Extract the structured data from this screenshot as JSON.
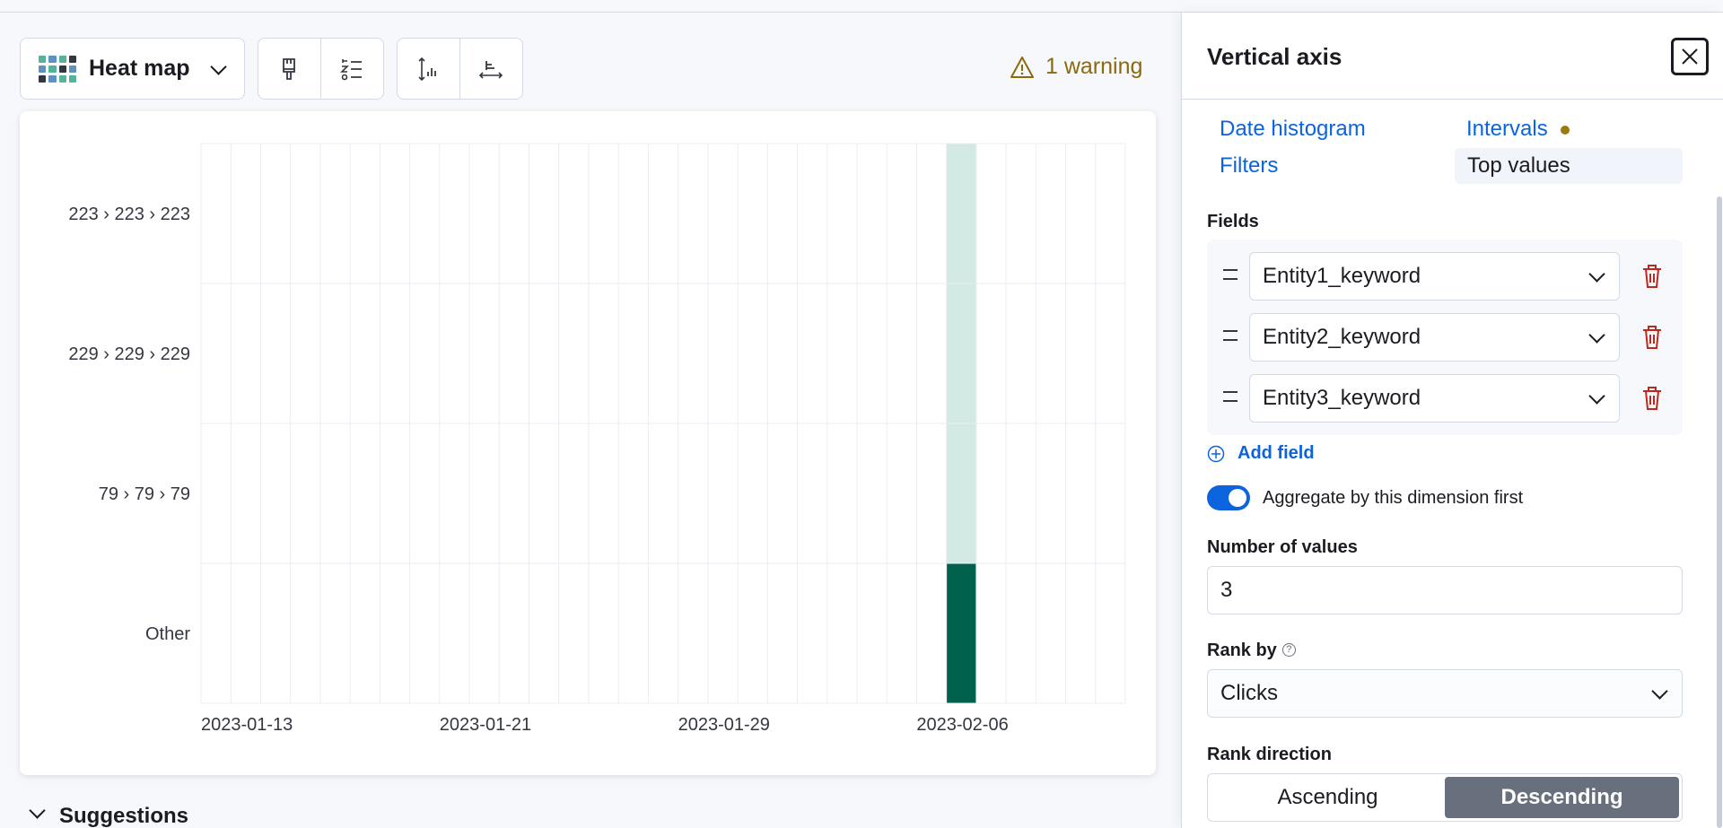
{
  "toolbar": {
    "chart_type_label": "Heat map",
    "warning_label": "1 warning"
  },
  "chart_data": {
    "type": "heatmap",
    "y_categories": [
      "223 › 223 › 223",
      "229 › 229 › 229",
      "79 › 79 › 79",
      "Other"
    ],
    "x_tick_labels": [
      "2023-01-13",
      "2023-01-21",
      "2023-01-29",
      "2023-02-06"
    ],
    "x_column_count": 31,
    "x_tick_columns": [
      0,
      8,
      16,
      24
    ],
    "cells": [
      {
        "column": 25,
        "row": "223 › 223 › 223",
        "intensity": 0.15
      },
      {
        "column": 25,
        "row": "229 › 229 › 229",
        "intensity": 0.15
      },
      {
        "column": 25,
        "row": "79 › 79 › 79",
        "intensity": 0.15
      },
      {
        "column": 25,
        "row": "Other",
        "intensity": 1.0
      }
    ],
    "colors": {
      "low": "#d3e9e3",
      "high": "#00614d",
      "grid": "#e9edf3"
    }
  },
  "suggestions": {
    "label": "Suggestions"
  },
  "flyout": {
    "title": "Vertical axis",
    "functions": {
      "date_histogram": "Date histogram",
      "intervals": "Intervals",
      "filters": "Filters",
      "top_values": "Top values"
    },
    "fields_label": "Fields",
    "fields": [
      "Entity1_keyword",
      "Entity2_keyword",
      "Entity3_keyword"
    ],
    "add_field": "Add field",
    "aggregate_toggle": "Aggregate by this dimension first",
    "number_of_values_label": "Number of values",
    "number_of_values": "3",
    "rank_by_label": "Rank by",
    "rank_by_value": "Clicks",
    "rank_direction_label": "Rank direction",
    "rank_direction": {
      "ascending": "Ascending",
      "descending": "Descending"
    }
  },
  "colors": {
    "link": "#0b64dd",
    "warning": "#8a6a0a",
    "heat_high": "#00614d"
  }
}
